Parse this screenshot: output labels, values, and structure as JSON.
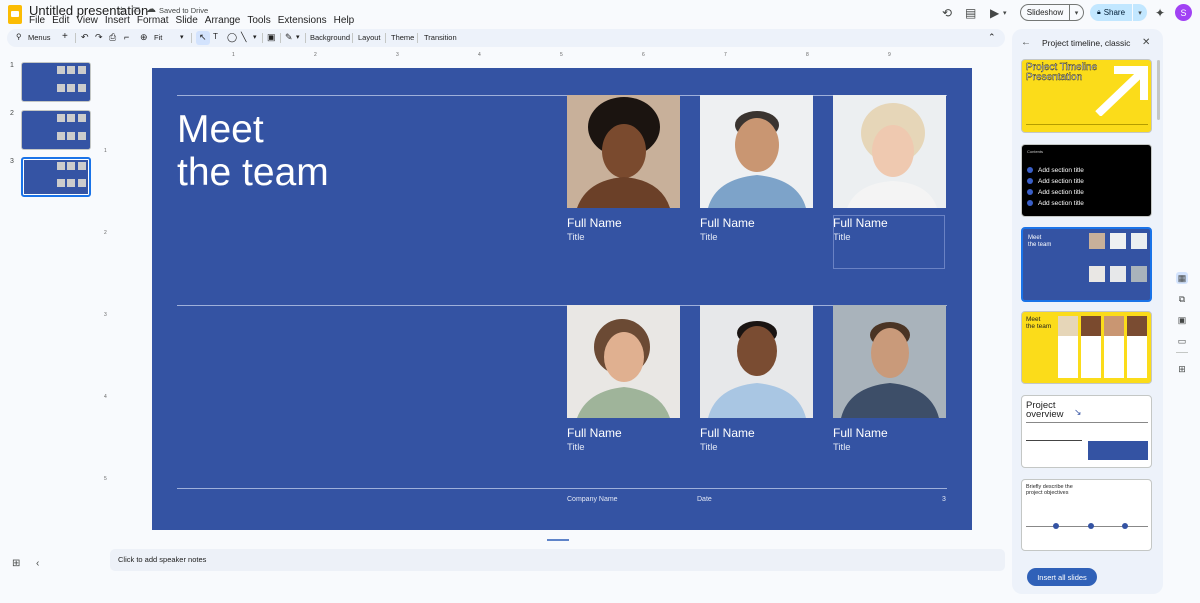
{
  "app": {
    "doc_title": "Untitled presentation",
    "save_status": "Saved to Drive",
    "menu": [
      "File",
      "Edit",
      "View",
      "Insert",
      "Format",
      "Slide",
      "Arrange",
      "Tools",
      "Extensions",
      "Help"
    ],
    "slideshow_label": "Slideshow",
    "share_label": "Share",
    "avatar_letter": "S"
  },
  "toolbar": {
    "search_label": "Menus",
    "zoom_label": "Fit",
    "background_label": "Background",
    "layout_label": "Layout",
    "theme_label": "Theme",
    "transition_label": "Transition"
  },
  "slides_panel": {
    "numbers": [
      "1",
      "2",
      "3"
    ],
    "thumb_text": "Meet\nthe team",
    "selected": 3
  },
  "rulers": {
    "top": [
      "1",
      "2",
      "3",
      "4",
      "5",
      "6",
      "7",
      "8",
      "9"
    ],
    "left": [
      "1",
      "2",
      "3",
      "4",
      "5"
    ]
  },
  "slide": {
    "title": "Meet\nthe team",
    "members": [
      {
        "name": "Full Name",
        "title": "Title"
      },
      {
        "name": "Full Name",
        "title": "Title"
      },
      {
        "name": "Full Name",
        "title": "Title"
      },
      {
        "name": "Full Name",
        "title": "Title"
      },
      {
        "name": "Full Name",
        "title": "Title"
      },
      {
        "name": "Full Name",
        "title": "Title"
      }
    ],
    "footer": {
      "company": "Company Name",
      "date": "Date",
      "page": "3"
    },
    "background_color": "#3453a3"
  },
  "notes": {
    "placeholder": "Click to add speaker notes"
  },
  "templates_panel": {
    "title": "Project timeline, classic",
    "tpl1_title": "Project Timeline\nPresentation",
    "tpl2_header": "Contents",
    "tpl2_items": [
      "Add section title",
      "Add section title",
      "Add section title",
      "Add section title"
    ],
    "tpl3_title": "Meet\nthe team",
    "tpl4_title": "Meet\nthe team",
    "tpl5_title": "Project\noverview",
    "tpl6_title": "Briefly describe the\nproject objectives",
    "insert_label": "Insert all slides"
  },
  "colors": {
    "accent": "#1a73e8",
    "slide_blue": "#3453a3",
    "yellow": "#fbdc1a",
    "share_bg": "#c2e7ff"
  }
}
